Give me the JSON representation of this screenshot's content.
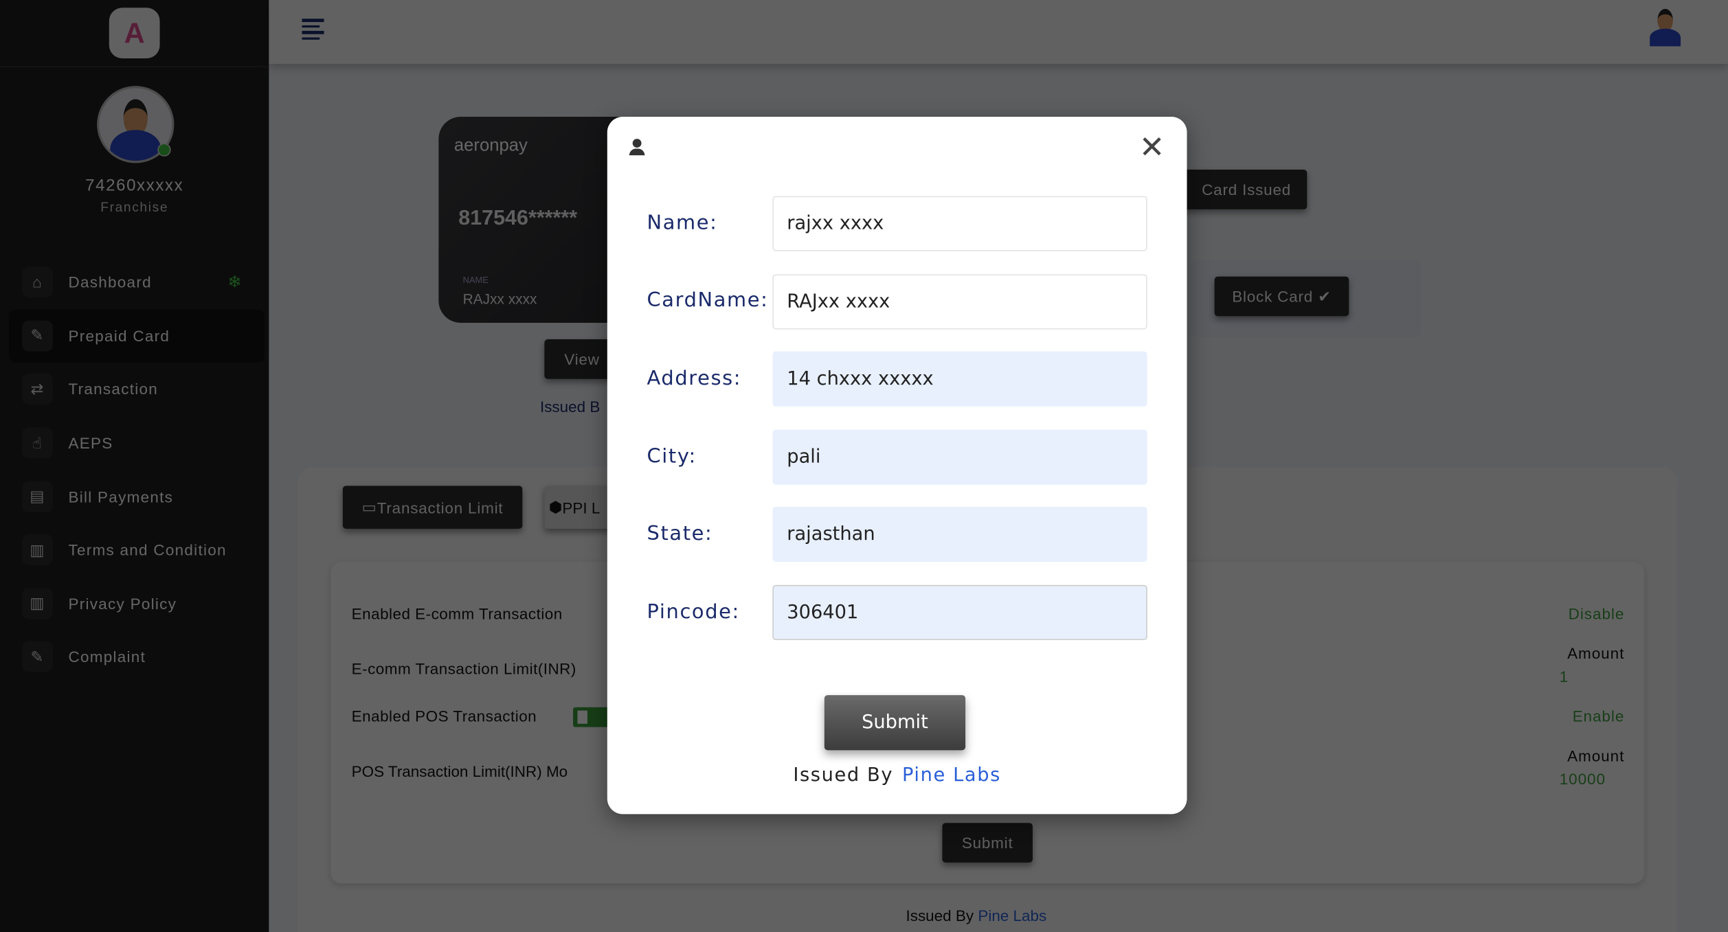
{
  "sidebar": {
    "logo_text": "A",
    "user_id": "74260xxxxx",
    "role": "Franchise",
    "items": [
      {
        "label": "Dashboard",
        "icon": "home-icon",
        "glyph": "⌂"
      },
      {
        "label": "Prepaid Card",
        "icon": "card-edit-icon",
        "glyph": "✎"
      },
      {
        "label": "Transaction",
        "icon": "money-exchange-icon",
        "glyph": "⇄"
      },
      {
        "label": "AEPS",
        "icon": "fingerprint-icon",
        "glyph": "☝"
      },
      {
        "label": "Bill Payments",
        "icon": "bill-icon",
        "glyph": "▤"
      },
      {
        "label": "Terms and Condition",
        "icon": "document-icon",
        "glyph": "▥"
      },
      {
        "label": "Privacy Policy",
        "icon": "document-icon",
        "glyph": "▥"
      },
      {
        "label": "Complaint",
        "icon": "edit-icon",
        "glyph": "✎"
      }
    ],
    "dashboard_badge": "❄"
  },
  "card": {
    "brand": "aeronpay",
    "number": "817546******",
    "name_label": "NAME",
    "name": "RAJxx xxxx"
  },
  "actions": {
    "view": "View",
    "issued_partial": "Issued B",
    "card_issued": "Card Issued",
    "block_card": "Block Card ✔"
  },
  "tabs": {
    "transaction_limit": "Transaction Limit",
    "ppi": "PPI L"
  },
  "limits": {
    "ecomm_enabled": "Enabled E-comm Transaction",
    "ecomm_status": "Disable",
    "ecomm_limit": "E-comm Transaction Limit(INR)",
    "amount_label": "Amount",
    "ecomm_amount": "1",
    "pos_enabled": "Enabled POS Transaction",
    "pos_status": "Enable",
    "pos_limit": "POS Transaction Limit(INR) Mo",
    "pos_amount": "10000",
    "submit": "Submit"
  },
  "footer": {
    "issued_by": "Issued By",
    "issuer": "Pine Labs"
  },
  "modal": {
    "close": "✕",
    "fields": [
      {
        "label": "Name:",
        "value": "rajxx xxxx"
      },
      {
        "label": "CardName:",
        "value": "RAJxx xxxx"
      },
      {
        "label": "Address:",
        "value": "14 chxxx xxxxx"
      },
      {
        "label": "City:",
        "value": "pali"
      },
      {
        "label": "State:",
        "value": "rajasthan"
      },
      {
        "label": "Pincode:",
        "value": "306401"
      }
    ],
    "submit": "Submit",
    "issued_by": "Issued By",
    "issuer": "Pine Labs"
  },
  "colors": {
    "accent_blue": "#2a5fd8",
    "status_green": "#3c9a3c",
    "navy": "#1a2a6a"
  }
}
